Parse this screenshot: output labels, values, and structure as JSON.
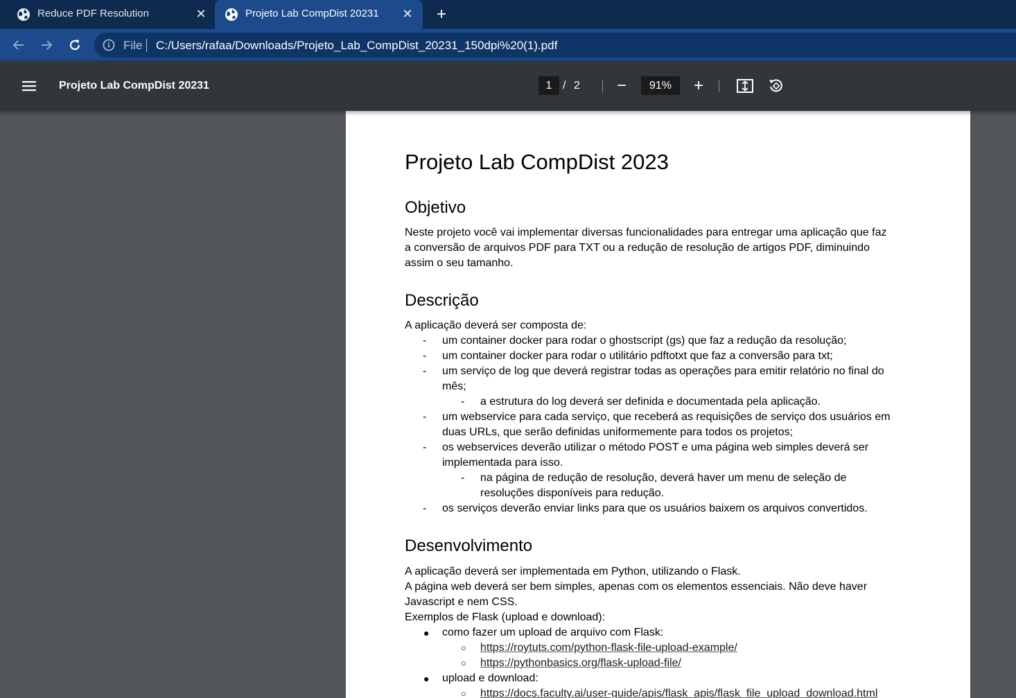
{
  "tabs": [
    {
      "title": "Reduce PDF Resolution",
      "active": false
    },
    {
      "title": "Projeto Lab CompDist 20231",
      "active": true
    }
  ],
  "new_tab_label": "+",
  "address": {
    "scheme_label": "File",
    "url": "C:/Users/rafaa/Downloads/Projeto_Lab_CompDist_20231_150dpi%20(1).pdf"
  },
  "pdf_toolbar": {
    "title": "Projeto Lab CompDist 20231",
    "page_current": "1",
    "page_sep": "/",
    "page_total": "2",
    "zoom": "91%",
    "zoom_out_label": "−",
    "zoom_in_label": "+"
  },
  "doc": {
    "title": "Projeto Lab CompDist 2023",
    "s1_heading": "Objetivo",
    "s1_lines": [
      "Neste projeto você vai implementar diversas funcionalidades para entregar uma aplicação que faz",
      "a conversão de arquivos PDF para TXT ou a redução de resolução de artigos PDF, diminuindo",
      "assim o seu tamanho."
    ],
    "s2_heading": "Descrição",
    "s2_intro": "A aplicação deverá ser composta de:",
    "s2_items": [
      {
        "marker": "-",
        "level": 1,
        "lines": [
          "um container docker para rodar o ghostscript (gs) que faz a redução da resolução;"
        ]
      },
      {
        "marker": "-",
        "level": 1,
        "lines": [
          "um container docker para rodar o utilitário pdftotxt que faz a conversão para txt;"
        ]
      },
      {
        "marker": "-",
        "level": 1,
        "lines": [
          "um serviço de log que deverá registrar todas as operações para emitir relatório no final do",
          "mês;"
        ]
      },
      {
        "marker": "-",
        "level": 2,
        "lines": [
          "a estrutura do log deverá ser definida e documentada pela aplicação."
        ]
      },
      {
        "marker": "-",
        "level": 1,
        "lines": [
          "um webservice para cada serviço, que receberá as requisições de serviço dos usuários em",
          "duas URLs, que serão definidas uniformemente para todos os projetos;"
        ]
      },
      {
        "marker": "-",
        "level": 1,
        "lines": [
          "os webservices deverão utilizar o método POST e uma página web simples deverá ser",
          "implementada para isso."
        ]
      },
      {
        "marker": "-",
        "level": 2,
        "lines": [
          "na página de redução de resolução, deverá haver um menu de seleção de",
          "resoluções disponíveis para redução."
        ]
      },
      {
        "marker": "-",
        "level": 1,
        "lines": [
          "os serviços deverão enviar links para que os usuários baixem os arquivos convertidos."
        ]
      }
    ],
    "s3_heading": "Desenvolvimento",
    "s3_lines": [
      "A aplicação deverá ser implementada em Python, utilizando o Flask.",
      "A página web deverá ser bem simples, apenas com os elementos essenciais. Não deve haver",
      "Javascript e nem CSS.",
      "Exemplos de Flask (upload e download):"
    ],
    "s3_items": [
      {
        "marker": "●",
        "level": 1,
        "text": "como fazer um upload de arquivo com Flask:",
        "link": false
      },
      {
        "marker": "○",
        "level": 2,
        "text": "https://roytuts.com/python-flask-file-upload-example/",
        "link": true
      },
      {
        "marker": "○",
        "level": 2,
        "text": "https://pythonbasics.org/flask-upload-file/",
        "link": true
      },
      {
        "marker": "●",
        "level": 1,
        "text": "upload e download:",
        "link": false
      },
      {
        "marker": "○",
        "level": 2,
        "text": "https://docs.faculty.ai/user-guide/apis/flask_apis/flask_file_upload_download.html",
        "link": true
      }
    ]
  }
}
